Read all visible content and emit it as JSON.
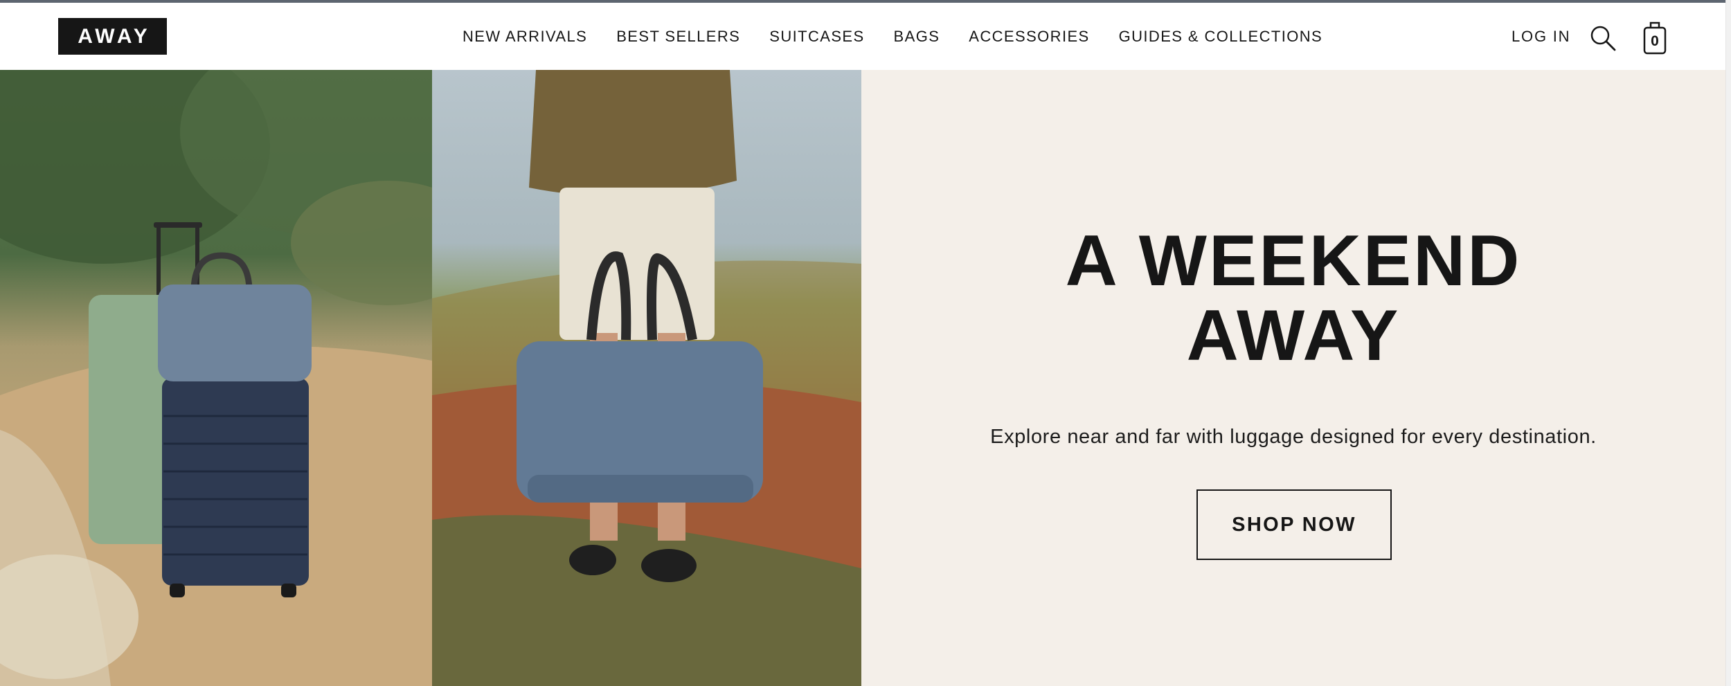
{
  "header": {
    "logo_text": "AWAY",
    "nav": [
      {
        "label": "NEW ARRIVALS"
      },
      {
        "label": "BEST SELLERS"
      },
      {
        "label": "SUITCASES"
      },
      {
        "label": "BAGS"
      },
      {
        "label": "ACCESSORIES"
      },
      {
        "label": "GUIDES & COLLECTIONS"
      }
    ],
    "login_label": "LOG IN",
    "search_icon": "search-icon",
    "cart_icon": "shopping-bag-icon",
    "cart_count": "0"
  },
  "hero": {
    "headline_line1": "A WEEKEND",
    "headline_line2": "AWAY",
    "subtext": "Explore near and far with luggage designed for every destination.",
    "cta_label": "SHOP NOW"
  },
  "colors": {
    "brand_dark": "#161616",
    "panel_background": "#f4efe9",
    "header_background": "#ffffff"
  }
}
